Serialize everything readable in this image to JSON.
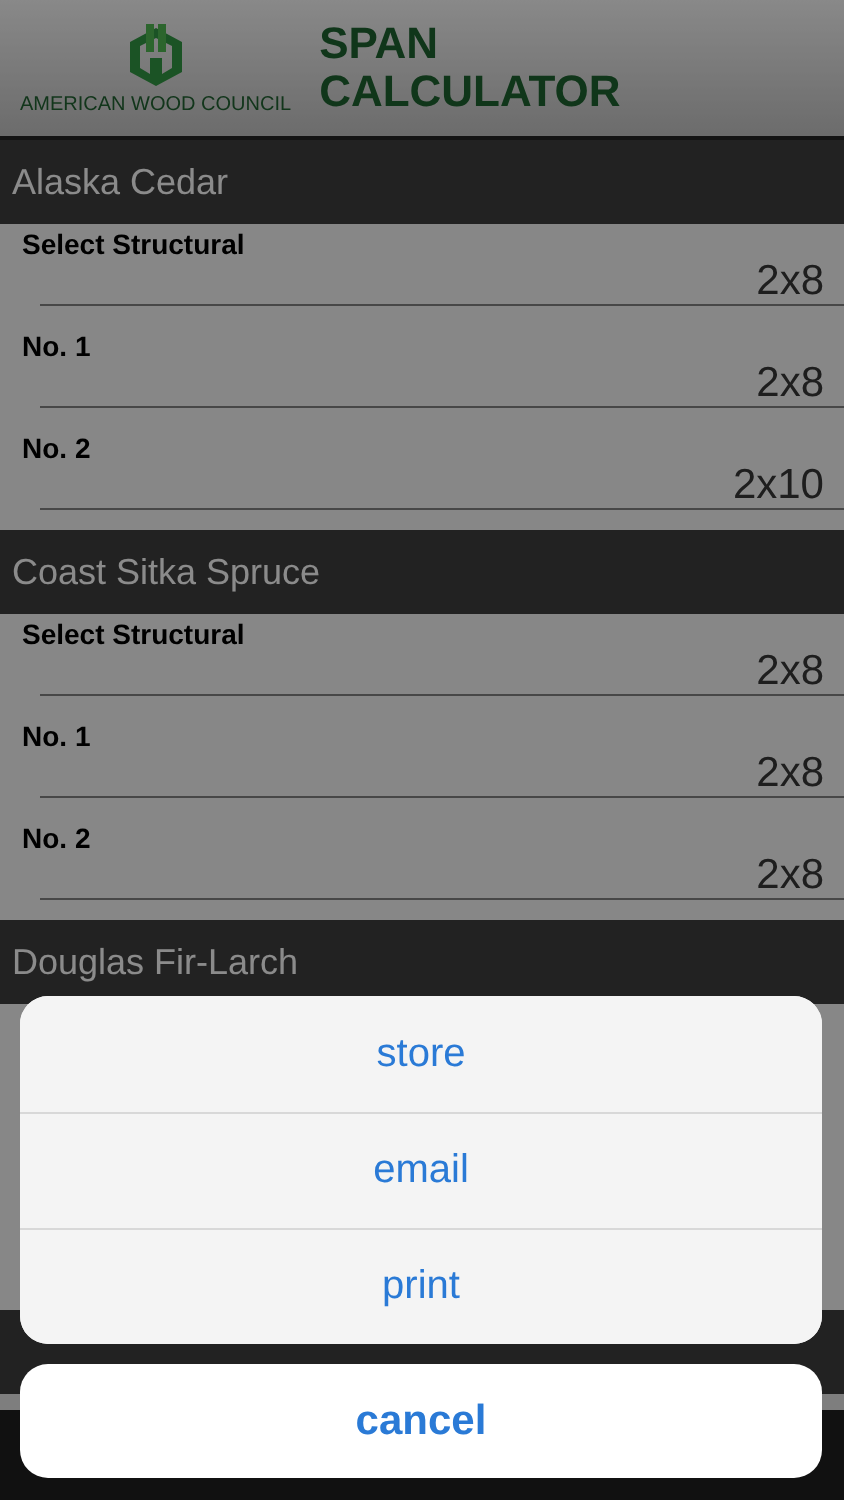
{
  "header": {
    "logo_text": "AMERICAN WOOD COUNCIL",
    "title_lines": [
      "SPAN",
      "CALCULATOR"
    ]
  },
  "sections": [
    {
      "title": "Alaska Cedar",
      "rows": [
        {
          "grade": "Select Structural",
          "size": "2x8"
        },
        {
          "grade": "No. 1",
          "size": "2x8"
        },
        {
          "grade": "No. 2",
          "size": "2x10"
        }
      ]
    },
    {
      "title": "Coast Sitka Spruce",
      "rows": [
        {
          "grade": "Select Structural",
          "size": "2x8"
        },
        {
          "grade": "No. 1",
          "size": "2x8"
        },
        {
          "grade": "No. 2",
          "size": "2x8"
        }
      ]
    },
    {
      "title": "Douglas Fir-Larch"
    }
  ],
  "action_sheet": {
    "actions": [
      "store",
      "email",
      "print"
    ],
    "cancel": "cancel"
  }
}
